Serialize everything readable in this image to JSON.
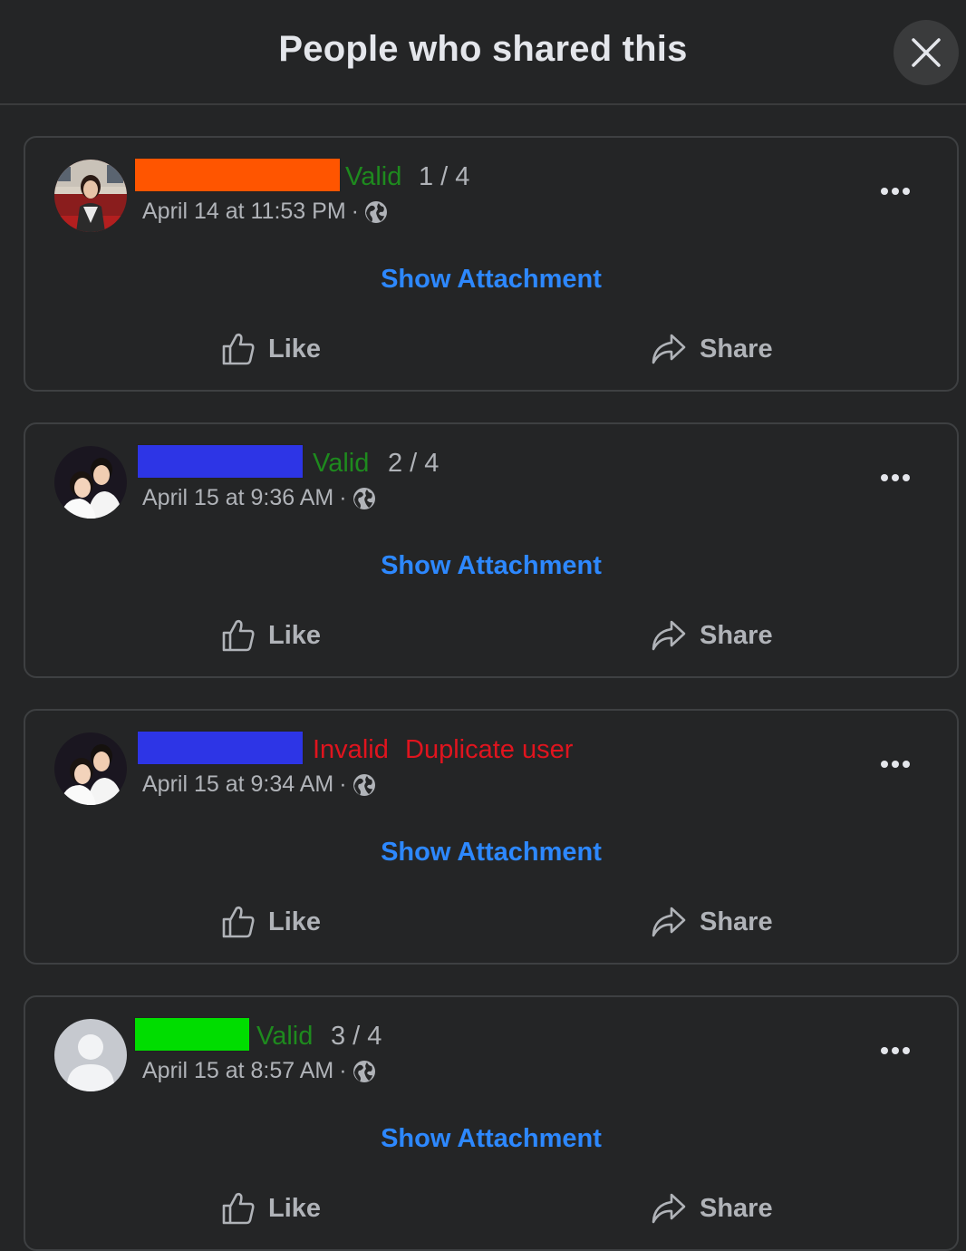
{
  "dialog": {
    "title": "People who shared this"
  },
  "labels": {
    "show_attachment": "Show Attachment",
    "like": "Like",
    "share": "Share"
  },
  "colors": {
    "valid": "#1e8a1e",
    "invalid": "#e0141e",
    "link": "#2d88ff"
  },
  "shares": [
    {
      "redaction_color": "#ff5500",
      "status": "Valid",
      "note": "1 / 4",
      "timestamp": "April 14 at 11:53 PM",
      "separator": "·",
      "avatar": "photo-woman-red-background"
    },
    {
      "redaction_color": "#2d35e6",
      "status": "Valid",
      "note": "2 / 4",
      "timestamp": "April 15 at 9:36 AM",
      "separator": "·",
      "avatar": "photo-couple"
    },
    {
      "redaction_color": "#2d35e6",
      "status": "Invalid",
      "note": "Duplicate user",
      "timestamp": "April 15 at 9:34 AM",
      "separator": "·",
      "avatar": "photo-couple"
    },
    {
      "redaction_color": "#00dd00",
      "status": "Valid",
      "note": "3 / 4",
      "timestamp": "April 15 at 8:57 AM",
      "separator": "·",
      "avatar": "default-profile-silhouette"
    }
  ]
}
